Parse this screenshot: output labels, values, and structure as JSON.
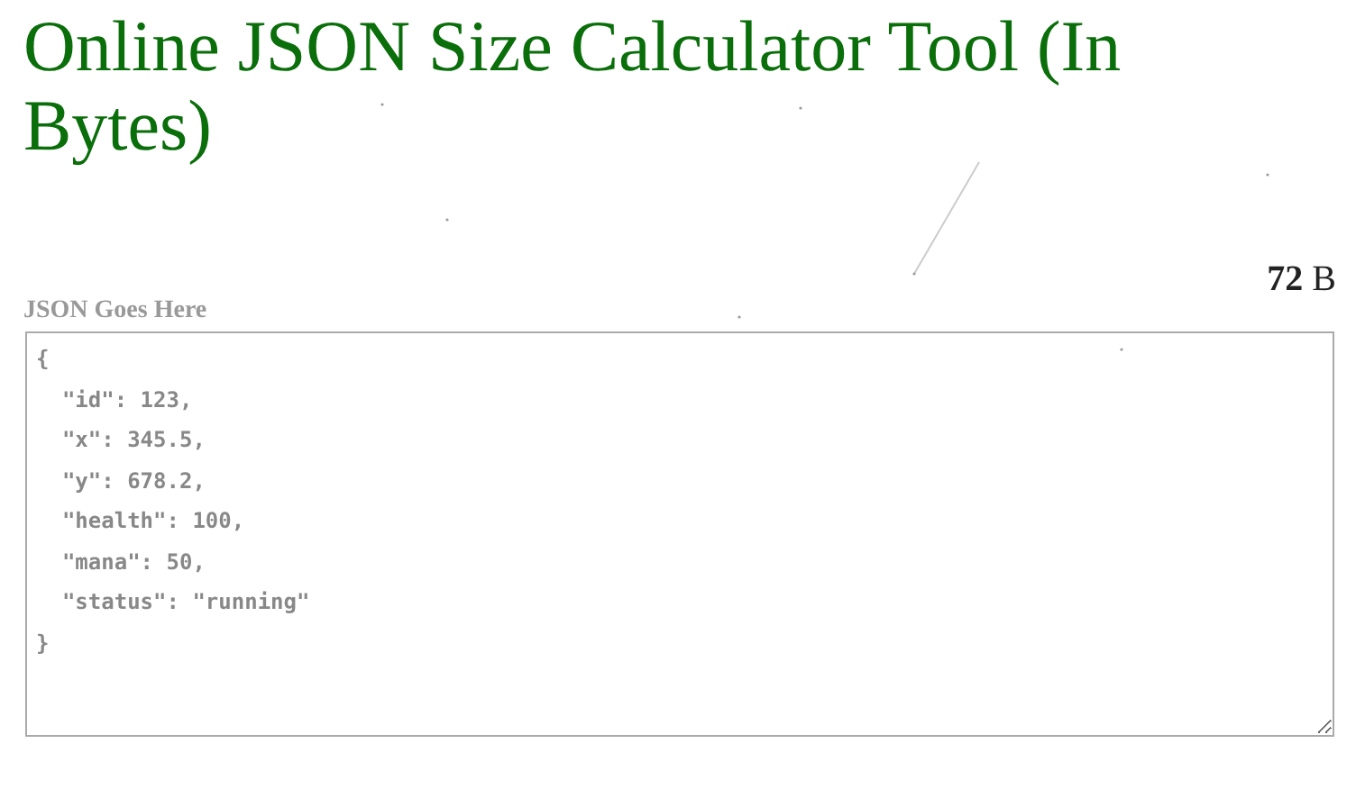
{
  "title": "Online JSON Size Calculator Tool (In Bytes)",
  "size": "**72** B",
  "editor": {
    "label": "JSON Goes Here",
    "value": "{\n  \"id\": 123,\n  \"x\": 345.5,\n  \"y\": 678.2,\n  \"health\": 100,\n  \"mana\": 50,\n  \"status\": \"running\"\n}"
  }
}
